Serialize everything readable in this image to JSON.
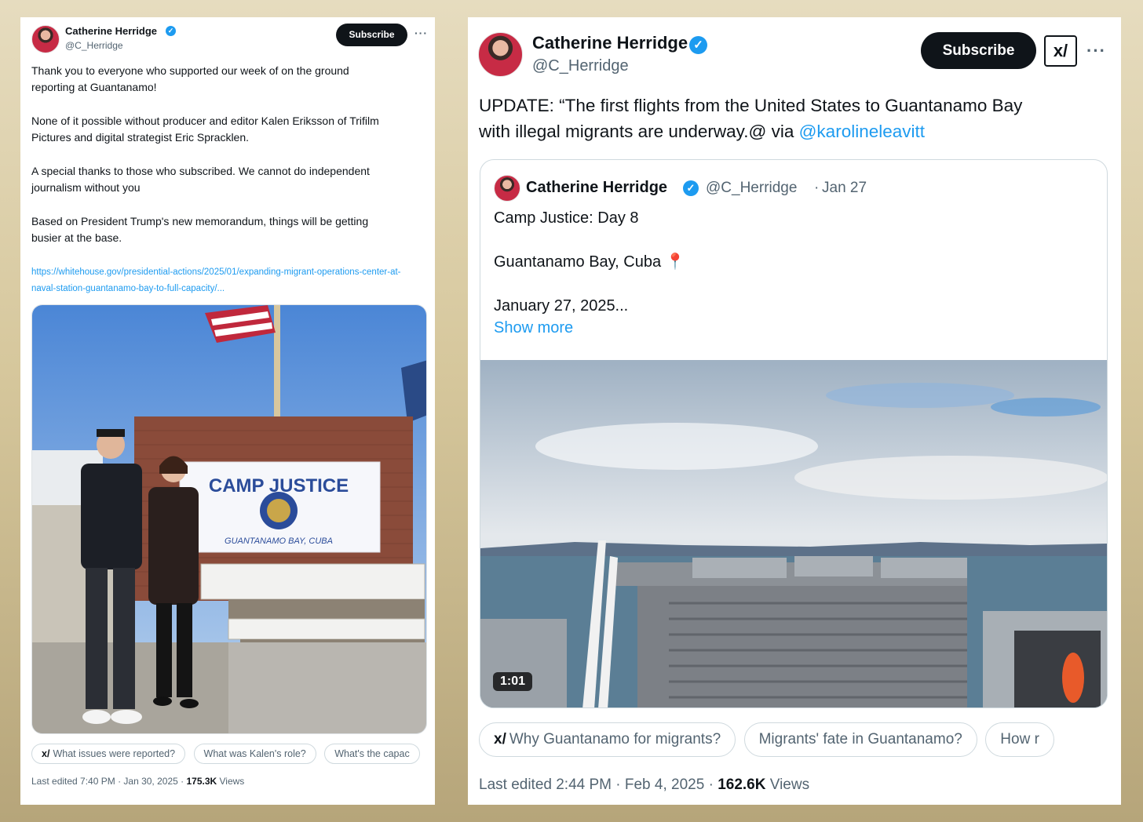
{
  "left_post": {
    "author": "Catherine Herridge",
    "handle": "@C_Herridge",
    "subscribe_label": "Subscribe",
    "more_label": "···",
    "verified_glyph": "✓",
    "body": "Thank you to everyone who supported our week of on the ground\nreporting at Guantanamo!\n\nNone of it possible without producer and editor Kalen Eriksson of Trifilm\nPictures and digital strategist Eric Spracklen.\n\nA special thanks to those who subscribed. We cannot do independent\njournalism without you\n\nBased on President Trump's new memorandum, things will be getting\nbusier at the base.",
    "url": "https://whitehouse.gov/presidential-actions/2025/01/expanding-migrant-operations-center-at-naval-station-guantanamo-bay-to-full-capacity/...",
    "photo": {
      "sign_line1": "CAMP  JUSTICE",
      "sign_line2": "GUANTANAMO BAY, CUBA"
    },
    "grok_glyph": "x/",
    "grok_prompts": [
      "What issues were reported?",
      "What was Kalen's role?",
      "What's the capac"
    ],
    "meta_prefix": "Last edited 7:40 PM · Jan 30, 2025 · ",
    "views_count": "175.3K",
    "views_label": " Views"
  },
  "right_post": {
    "author": "Catherine Herridge",
    "handle": "@C_Herridge",
    "subscribe_label": "Subscribe",
    "xlogo_label": "x/",
    "more_label": "···",
    "verified_glyph": "✓",
    "body_text": "UPDATE: “The first flights from the United States to Guantanamo Bay\nwith illegal migrants are underway.@ via ",
    "body_mention": "@karolineleavitt",
    "quote": {
      "author": "Catherine Herridge",
      "handle": "@C_Herridge",
      "dot": "·",
      "date": "Jan 27",
      "text": "Camp Justice: Day 8\n\nGuantanamo Bay, Cuba 📍\n\nJanuary 27, 2025...",
      "show_more": "Show more",
      "video_duration": "1:01"
    },
    "grok_glyph": "x/",
    "grok_prompts": [
      "Why Guantanamo for migrants?",
      "Migrants' fate in Guantanamo?",
      "How r"
    ],
    "meta_prefix": "Last edited 2:44 PM · Feb 4, 2025 · ",
    "views_count": "162.6K",
    "views_label": " Views"
  },
  "colors": {
    "accent": "#1d9bf0",
    "text": "#0f1419",
    "muted": "#536471",
    "button": "#0f1419"
  }
}
